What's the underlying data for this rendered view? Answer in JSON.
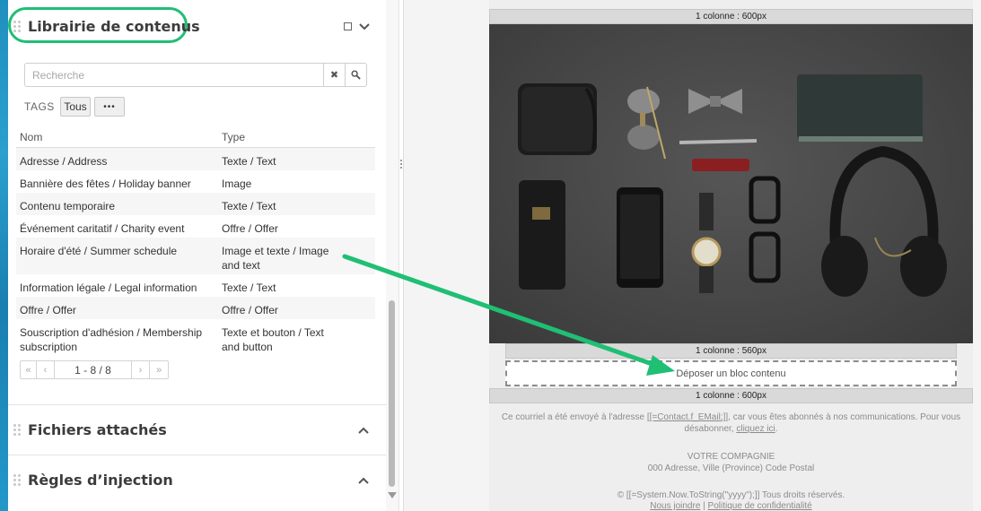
{
  "library": {
    "title": "Librairie de contenus",
    "search_placeholder": "Recherche",
    "clear_icon": "✖",
    "tags_label": "TAGS",
    "tag_all": "Tous",
    "tag_more": "•••",
    "columns": {
      "name": "Nom",
      "type": "Type"
    },
    "rows": [
      {
        "name": "Adresse / Address",
        "type": "Texte / Text"
      },
      {
        "name": "Bannière des fêtes / Holiday banner",
        "type": "Image"
      },
      {
        "name": "Contenu temporaire",
        "type": "Texte / Text"
      },
      {
        "name": "Événement caritatif / Charity event",
        "type": "Offre / Offer"
      },
      {
        "name": "Horaire d'été / Summer schedule",
        "type": "Image et texte / Image and text"
      },
      {
        "name": "Information légale / Legal information",
        "type": "Texte / Text"
      },
      {
        "name": "Offre / Offer",
        "type": "Offre / Offer"
      },
      {
        "name": "Souscription d'adhésion / Membership subscription",
        "type": "Texte et bouton / Text and button"
      }
    ],
    "pager": {
      "first": "«",
      "prev": "‹",
      "info": "1 - 8 / 8",
      "next": "›",
      "last": "»"
    }
  },
  "sections": {
    "attachments": "Fichiers attachés",
    "injection_rules": "Règles d’injection"
  },
  "email": {
    "col_600_top": "1 colonne : 600px",
    "col_560": "1 colonne : 560px",
    "dropzone": "Déposer un bloc contenu",
    "col_600_bottom": "1 colonne : 600px",
    "footer": {
      "line1_a": "Ce courriel a été envoyé à l'adresse ",
      "line1_link": "[[=Contact.f_EMail;]]",
      "line1_b": ", car vous êtes abonnés à nos communications. Pour vous désabonner, ",
      "line1_unsub": "cliquez ici",
      "line1_end": ".",
      "company": "VOTRE COMPAGNIE",
      "address": "000 Adresse, Ville (Province) Code Postal",
      "copyright": "© [[=System.Now.ToString(\"yyyy\");]] Tous droits réservés.",
      "join": "Nous joindre",
      "sep": " | ",
      "privacy": "Politique de confidentialité"
    }
  },
  "colors": {
    "highlight": "#1fbf74",
    "arrow": "#1fbf74"
  }
}
